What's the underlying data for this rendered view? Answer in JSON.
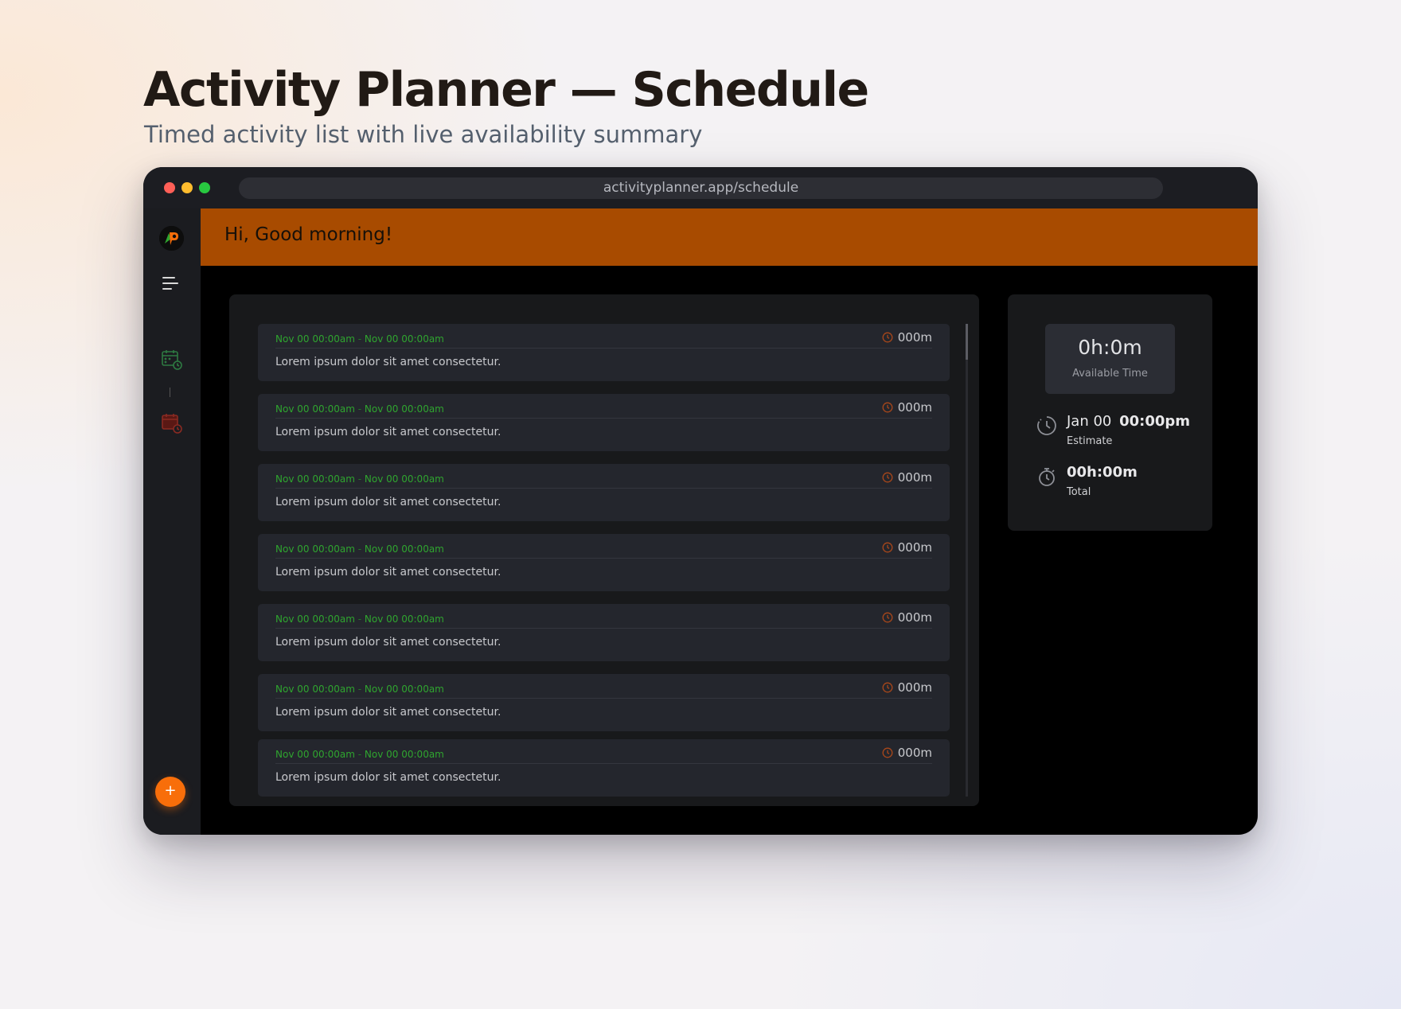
{
  "page": {
    "title": "Activity Planner — Schedule",
    "subtitle": "Timed activity list with live availability summary"
  },
  "browser": {
    "url": "activityplanner.app/schedule"
  },
  "header": {
    "greeting": "Hi, Good morning!"
  },
  "sidebar": {
    "logo_icon": "ap-logo-icon",
    "menu_icon": "hamburger-menu-icon",
    "calendar_icons": [
      "calendar-clock-icon-green",
      "calendar-clock-icon-red"
    ],
    "add_button_label": "+"
  },
  "activities": [
    {
      "start": "Nov 00  00:00am",
      "separator": " - ",
      "end": "Nov 00  00:00am",
      "duration": "000m",
      "description": "Lorem ipsum dolor sit amet consectetur."
    },
    {
      "start": "Nov 00  00:00am",
      "separator": " - ",
      "end": "Nov 00  00:00am",
      "duration": "000m",
      "description": "Lorem ipsum dolor sit amet consectetur."
    },
    {
      "start": "Nov 00  00:00am",
      "separator": " - ",
      "end": "Nov 00  00:00am",
      "duration": "000m",
      "description": "Lorem ipsum dolor sit amet consectetur."
    },
    {
      "start": "Nov 00  00:00am",
      "separator": " - ",
      "end": "Nov 00  00:00am",
      "duration": "000m",
      "description": "Lorem ipsum dolor sit amet consectetur."
    },
    {
      "start": "Nov 00  00:00am",
      "separator": " - ",
      "end": "Nov 00  00:00am",
      "duration": "000m",
      "description": "Lorem ipsum dolor sit amet consectetur."
    },
    {
      "start": "Nov 00  00:00am",
      "separator": " - ",
      "end": "Nov 00  00:00am",
      "duration": "000m",
      "description": "Lorem ipsum dolor sit amet consectetur."
    },
    {
      "start": "Nov 00  00:00am",
      "separator": " - ",
      "end": "Nov 00  00:00am",
      "duration": "000m",
      "description": "Lorem ipsum dolor sit amet consectetur."
    }
  ],
  "summary": {
    "available_time": "0h:0m",
    "available_label": "Available Time",
    "estimate_date": "Jan 00",
    "estimate_time": "00:00pm",
    "estimate_label": "Estimate",
    "total_value": "00h:00m",
    "total_label": "Total"
  },
  "colors": {
    "accent_orange": "#a84b00",
    "fab_orange": "#f86e0a",
    "range_green": "#2fa52f",
    "card_bg": "#24262d"
  }
}
